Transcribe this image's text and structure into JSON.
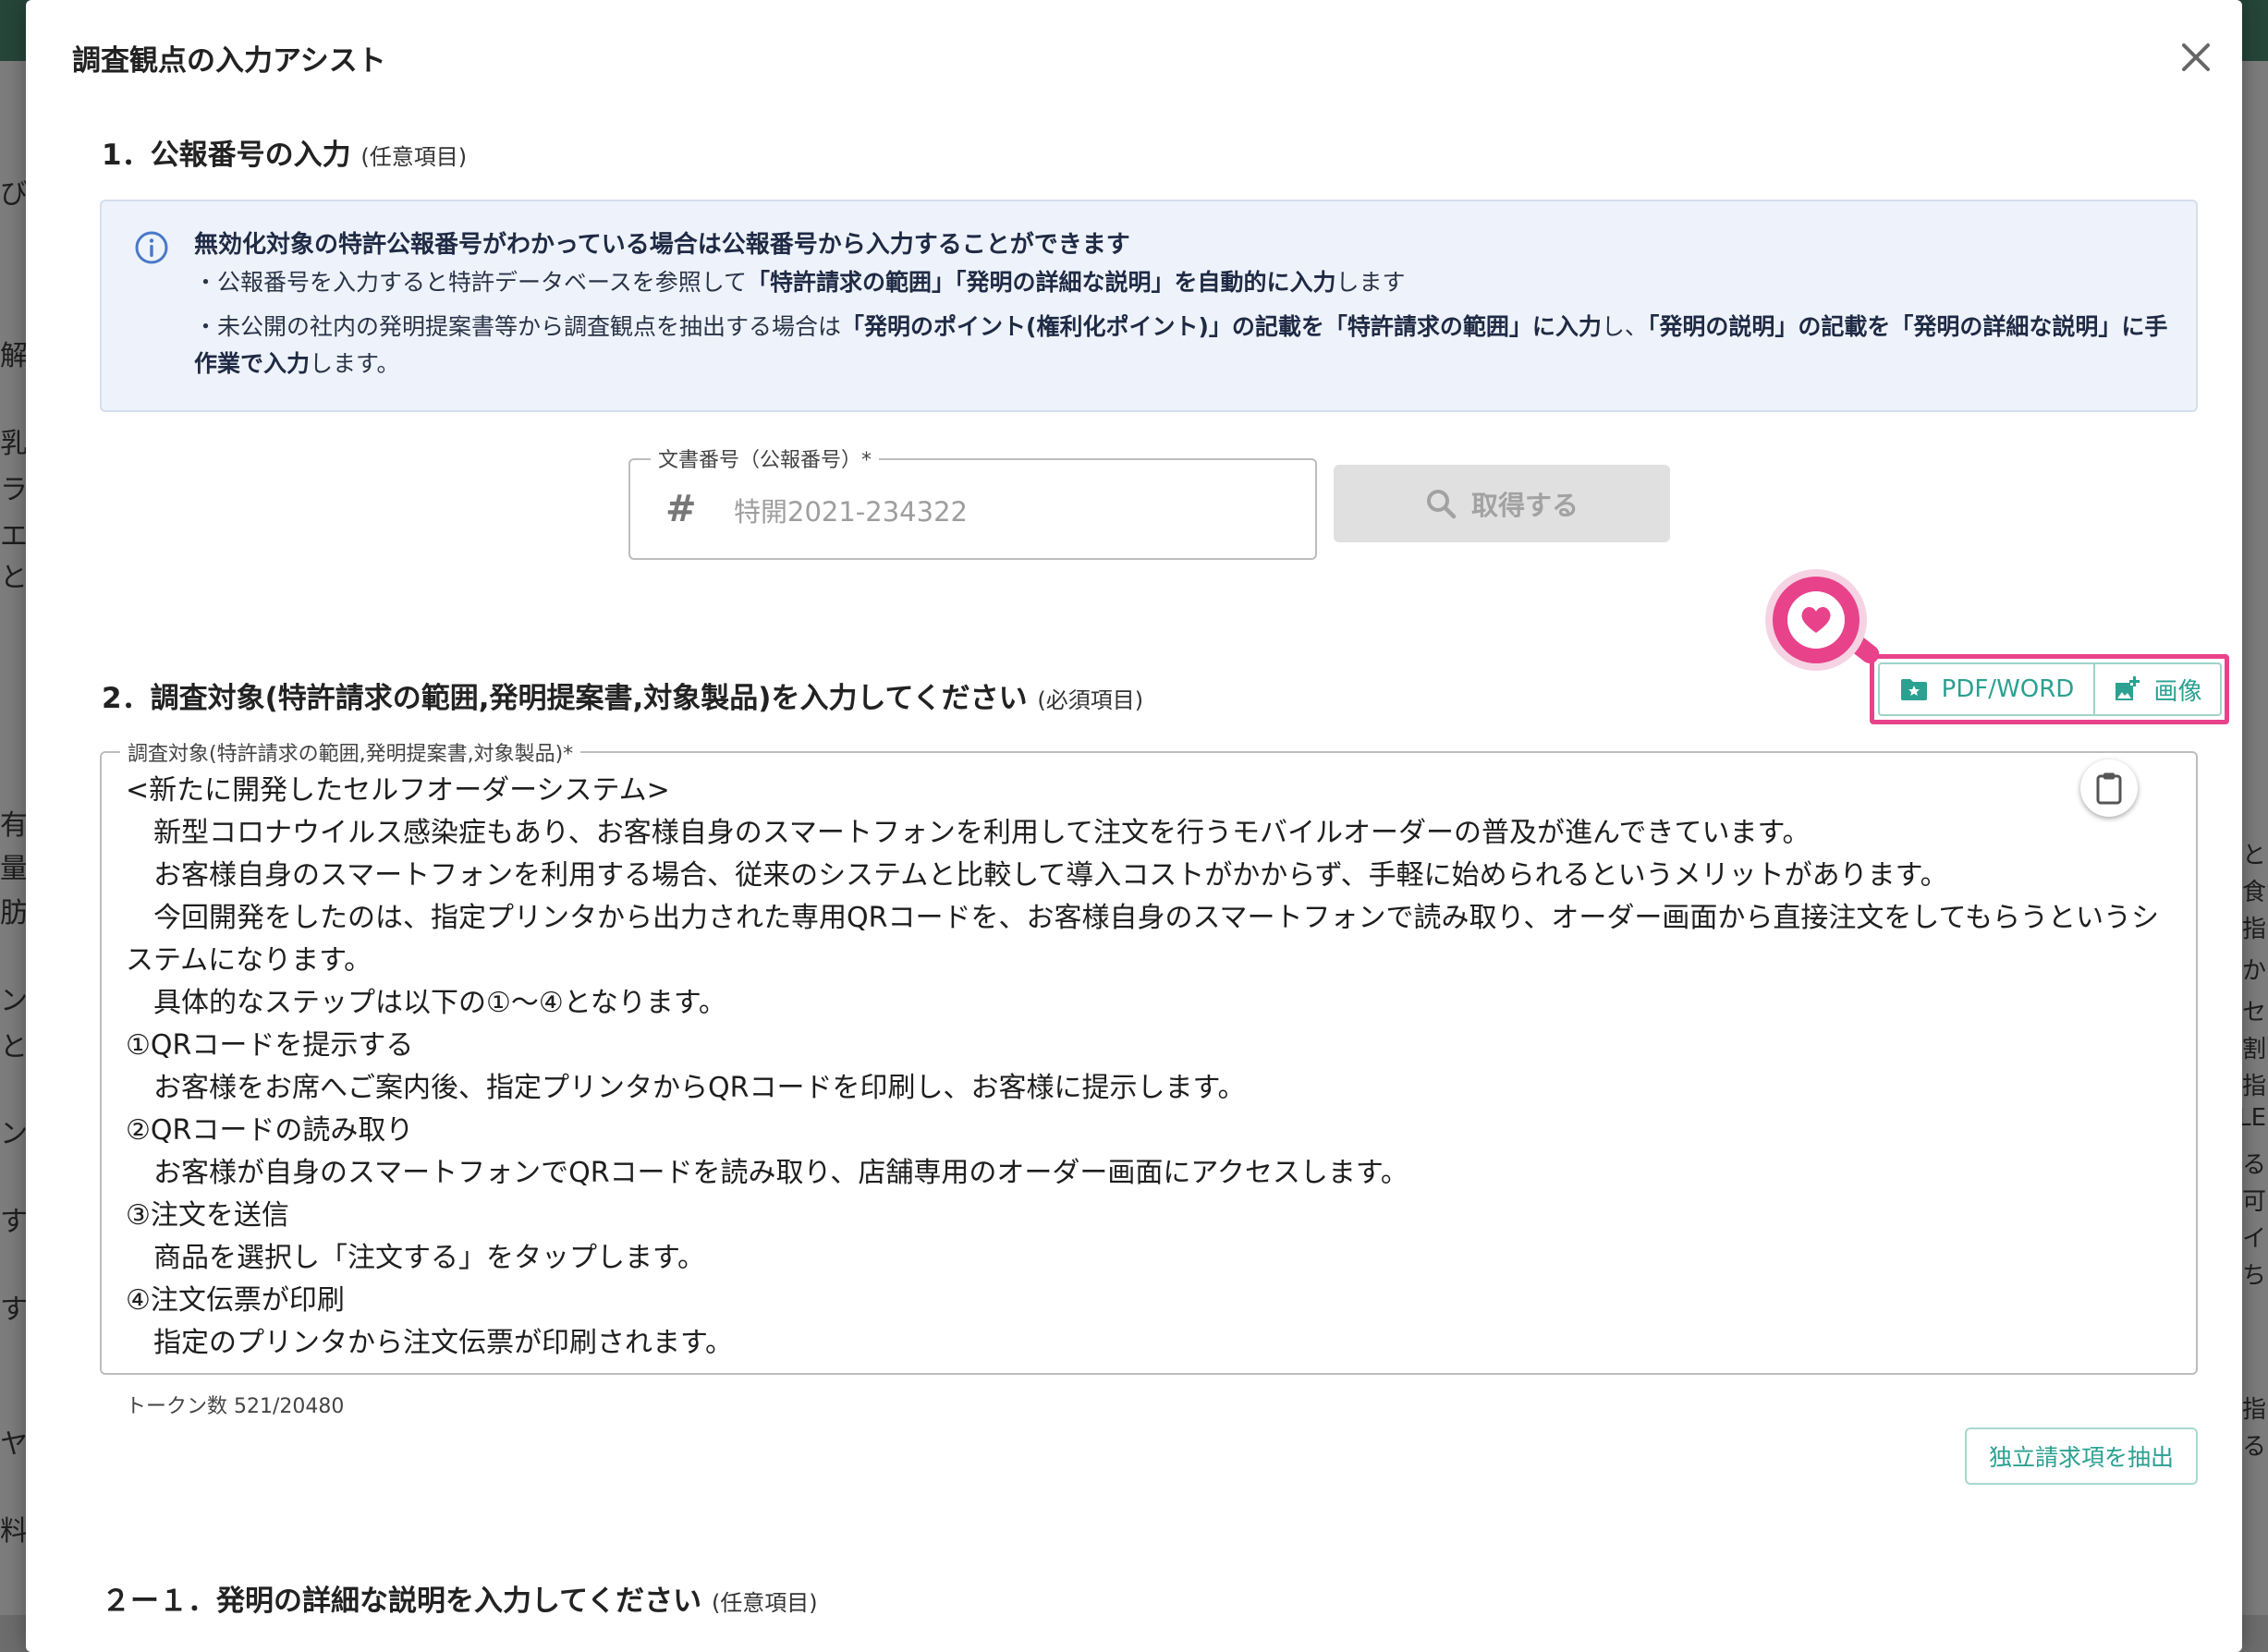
{
  "background": {
    "left_chars": [
      "び",
      "解",
      "乳",
      "ラ",
      "エ",
      "と",
      "有",
      "量",
      "肪",
      "ン",
      "と",
      "ン",
      "す",
      "す",
      "ヤ",
      "料"
    ],
    "right_chars": [
      "と",
      "食",
      "指",
      "か",
      "セ",
      "割",
      "指",
      "LE",
      "る",
      "可",
      "イ",
      "ち",
      "指",
      "る"
    ]
  },
  "modal": {
    "title": "調査観点の入力アシスト"
  },
  "section1": {
    "heading": "1．公報番号の入力",
    "optional": "(任意項目)"
  },
  "info": {
    "title": "無効化対象の特許公報番号がわかっている場合は公報番号から入力することができます",
    "line1_a": "・公報番号を入力すると特許データベースを参照して",
    "line1_b": "「特許請求の範囲」「発明の詳細な説明」を自動的に入力",
    "line1_c": "します",
    "line2_a": "・未公開の社内の発明提案書等から調査観点を抽出する場合は",
    "line2_b": "「発明のポイント(権利化ポイント)」の記載を「特許請求の範囲」に入力",
    "line2_c": "し、",
    "line2_d": "「発明の説明」の記載を「発明の詳細な説明」に手作業で入力",
    "line2_e": "します。"
  },
  "doc_field": {
    "label": "文書番号（公報番号）*",
    "placeholder": "特開2021-234322"
  },
  "fetch_button": "取得する",
  "section2": {
    "heading": "2．調査対象(特許請求の範囲,発明提案書,対象製品)を入力してください",
    "required": "(必須項目)"
  },
  "upload": {
    "pdf_label": "PDF/WORD",
    "image_label": "画像"
  },
  "target": {
    "label": "調査対象(特許請求の範囲,発明提案書,対象製品)*",
    "text": "<新たに開発したセルフオーダーシステム>\n　新型コロナウイルス感染症もあり、お客様自身のスマートフォンを利用して注文を行うモバイルオーダーの普及が進んできています。\n　お客様自身のスマートフォンを利用する場合、従来のシステムと比較して導入コストがかからず、手軽に始められるというメリットがあります。\n　今回開発をしたのは、指定プリンタから出力された専用QRコードを、お客様自身のスマートフォンで読み取り、オーダー画面から直接注文をしてもらうというシステムになります。\n　具体的なステップは以下の①～④となります。\n①QRコードを提示する\n　お客様をお席へご案内後、指定プリンタからQRコードを印刷し、お客様に提示します。\n②QRコードの読み取り\n　お客様が自身のスマートフォンでQRコードを読み取り、店舗専用のオーダー画面にアクセスします。\n③注文を送信\n　商品を選択し「注文する」をタップします。\n④注文伝票が印刷\n　指定のプリンタから注文伝票が印刷されます。",
    "token_count": "トークン数 521/20480"
  },
  "extract_button": "独立請求項を抽出",
  "section21": {
    "heading": "２ー１．発明の詳細な説明を入力してください",
    "optional": "(任意項目)"
  },
  "colors": {
    "accent": "#2aa191",
    "highlight": "#e8428b",
    "info_bg": "#eef3fb"
  }
}
